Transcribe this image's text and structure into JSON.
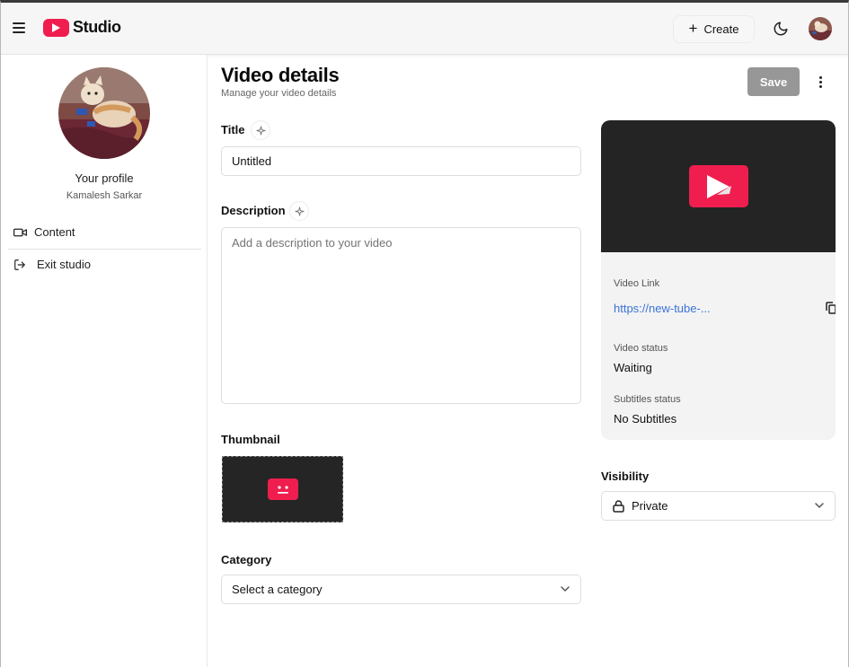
{
  "header": {
    "brand": "Studio",
    "create_label": "Create"
  },
  "sidebar": {
    "profile_title": "Your profile",
    "profile_name": "Kamalesh Sarkar",
    "items": [
      {
        "label": "Content"
      },
      {
        "label": "Exit studio"
      }
    ]
  },
  "main": {
    "title": "Video details",
    "subtitle": "Manage your video details",
    "save_label": "Save",
    "title_field": {
      "label": "Title",
      "value": "Untitled"
    },
    "description_field": {
      "label": "Description",
      "value": "",
      "placeholder": "Add a description to your video"
    },
    "thumbnail_label": "Thumbnail",
    "category": {
      "label": "Category",
      "value": "Select a category"
    }
  },
  "video_card": {
    "link_label": "Video Link",
    "link_value": "https://new-tube-...",
    "status_label": "Video status",
    "status_value": "Waiting",
    "subtitles_label": "Subtitles status",
    "subtitles_value": "No Subtitles"
  },
  "visibility": {
    "label": "Visibility",
    "value": "Private"
  },
  "colors": {
    "accent": "#ef1e4f",
    "link": "#3a73d6",
    "save_disabled": "#979797",
    "preview_bg": "#242424"
  },
  "icons": [
    "menu-icon",
    "youtube-logo-icon",
    "plus-icon",
    "moon-icon",
    "video-camera-icon",
    "exit-icon",
    "sparkle-icon",
    "play-icon",
    "broken-thumbnail-icon",
    "copy-icon",
    "lock-icon",
    "chevron-down-icon",
    "more-vertical-icon"
  ]
}
